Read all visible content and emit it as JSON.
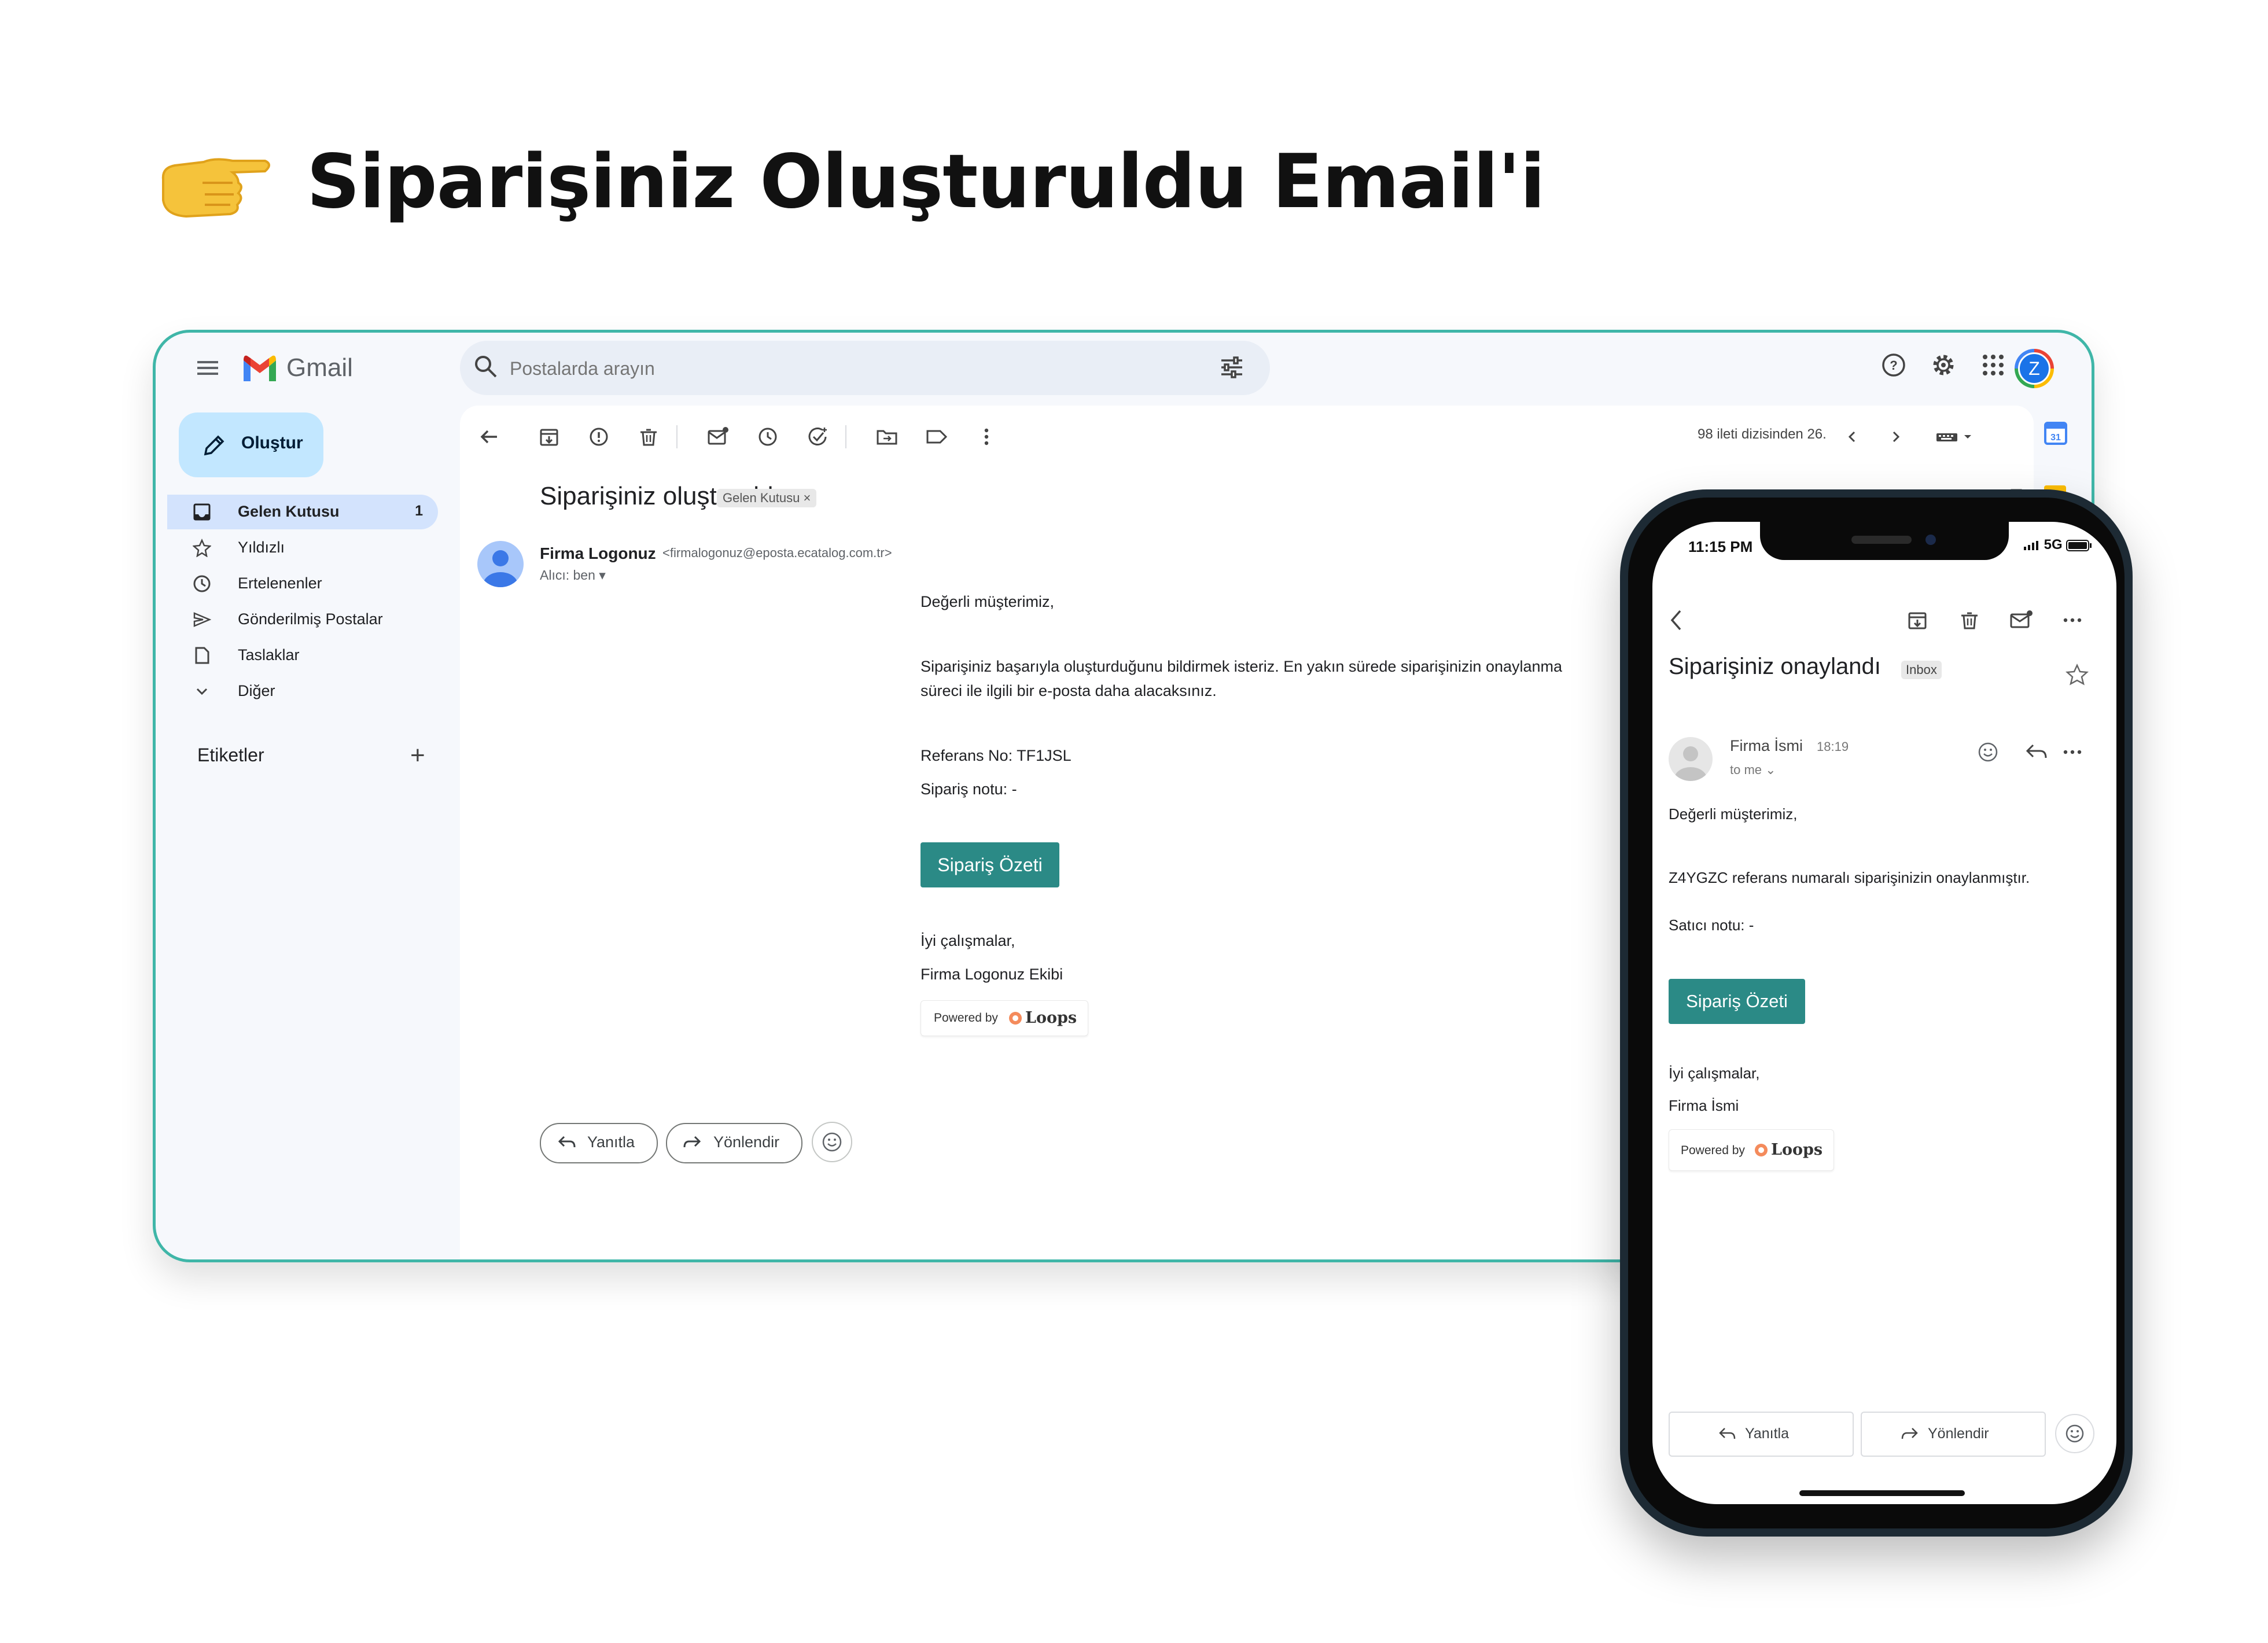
{
  "page": {
    "title": "Siparişiniz Oluşturuldu Email'i"
  },
  "desktop": {
    "app_name": "Gmail",
    "search": {
      "placeholder": "Postalarda arayın"
    },
    "compose_label": "Oluştur",
    "nav": [
      {
        "label": "Gelen Kutusu",
        "count": "1",
        "icon": "inbox-icon"
      },
      {
        "label": "Yıldızlı",
        "icon": "star-icon"
      },
      {
        "label": "Ertelenenler",
        "icon": "clock-icon"
      },
      {
        "label": "Gönderilmiş Postalar",
        "icon": "send-icon"
      },
      {
        "label": "Taslaklar",
        "icon": "draft-icon"
      },
      {
        "label": "Diğer",
        "icon": "chevron-down-icon"
      }
    ],
    "labels_heading": "Etiketler",
    "pager": "98 ileti dizisinden 26.",
    "email": {
      "subject": "Siparişiniz oluşturuldu",
      "folder_chip": "Gelen Kutusu",
      "sender_name": "Firma Logonuz",
      "sender_email": "<firmalogonuz@eposta.ecatalog.com.tr>",
      "to_line": "Alıcı: ben",
      "greeting": "Değerli müşterimiz,",
      "paragraph_line1": "Siparişiniz başarıyla oluşturduğunu bildirmek isteriz. En yakın sürede siparişinizin onaylanma",
      "paragraph_line2": "süreci ile ilgili bir e-posta daha alacaksınız.",
      "reference": "Referans No: TF1JSL",
      "order_note": "Sipariş notu: -",
      "button_label": "Sipariş Özeti",
      "closing": "İyi çalışmalar,",
      "signature": "Firma Logonuz Ekibi",
      "powered_by": "Powered by",
      "powered_brand": "Loops"
    },
    "reply_label": "Yanıtla",
    "forward_label": "Yönlendir",
    "avatar_letter": "Z"
  },
  "phone": {
    "time": "11:15 PM",
    "network": "5G",
    "email": {
      "subject": "Siparişiniz onaylandı",
      "folder_chip": "Inbox",
      "sender_name": "Firma İsmi",
      "sent_time": "18:19",
      "to_line": "to me",
      "greeting": "Değerli müşterimiz,",
      "paragraph": "Z4YGZC referans numaralı siparişinizin onaylanmıştır.",
      "seller_note": "Satıcı notu: -",
      "button_label": "Sipariş Özeti",
      "closing": "İyi çalışmalar,",
      "signature": "Firma İsmi",
      "powered_by": "Powered by",
      "powered_brand": "Loops"
    },
    "reply_label": "Yanıtla",
    "forward_label": "Yönlendir"
  },
  "colors": {
    "accent_teal": "#2b8a86",
    "frame_teal": "#3fb6a8",
    "selected_nav": "#d3e3fd",
    "compose_bg": "#c2e7ff"
  }
}
